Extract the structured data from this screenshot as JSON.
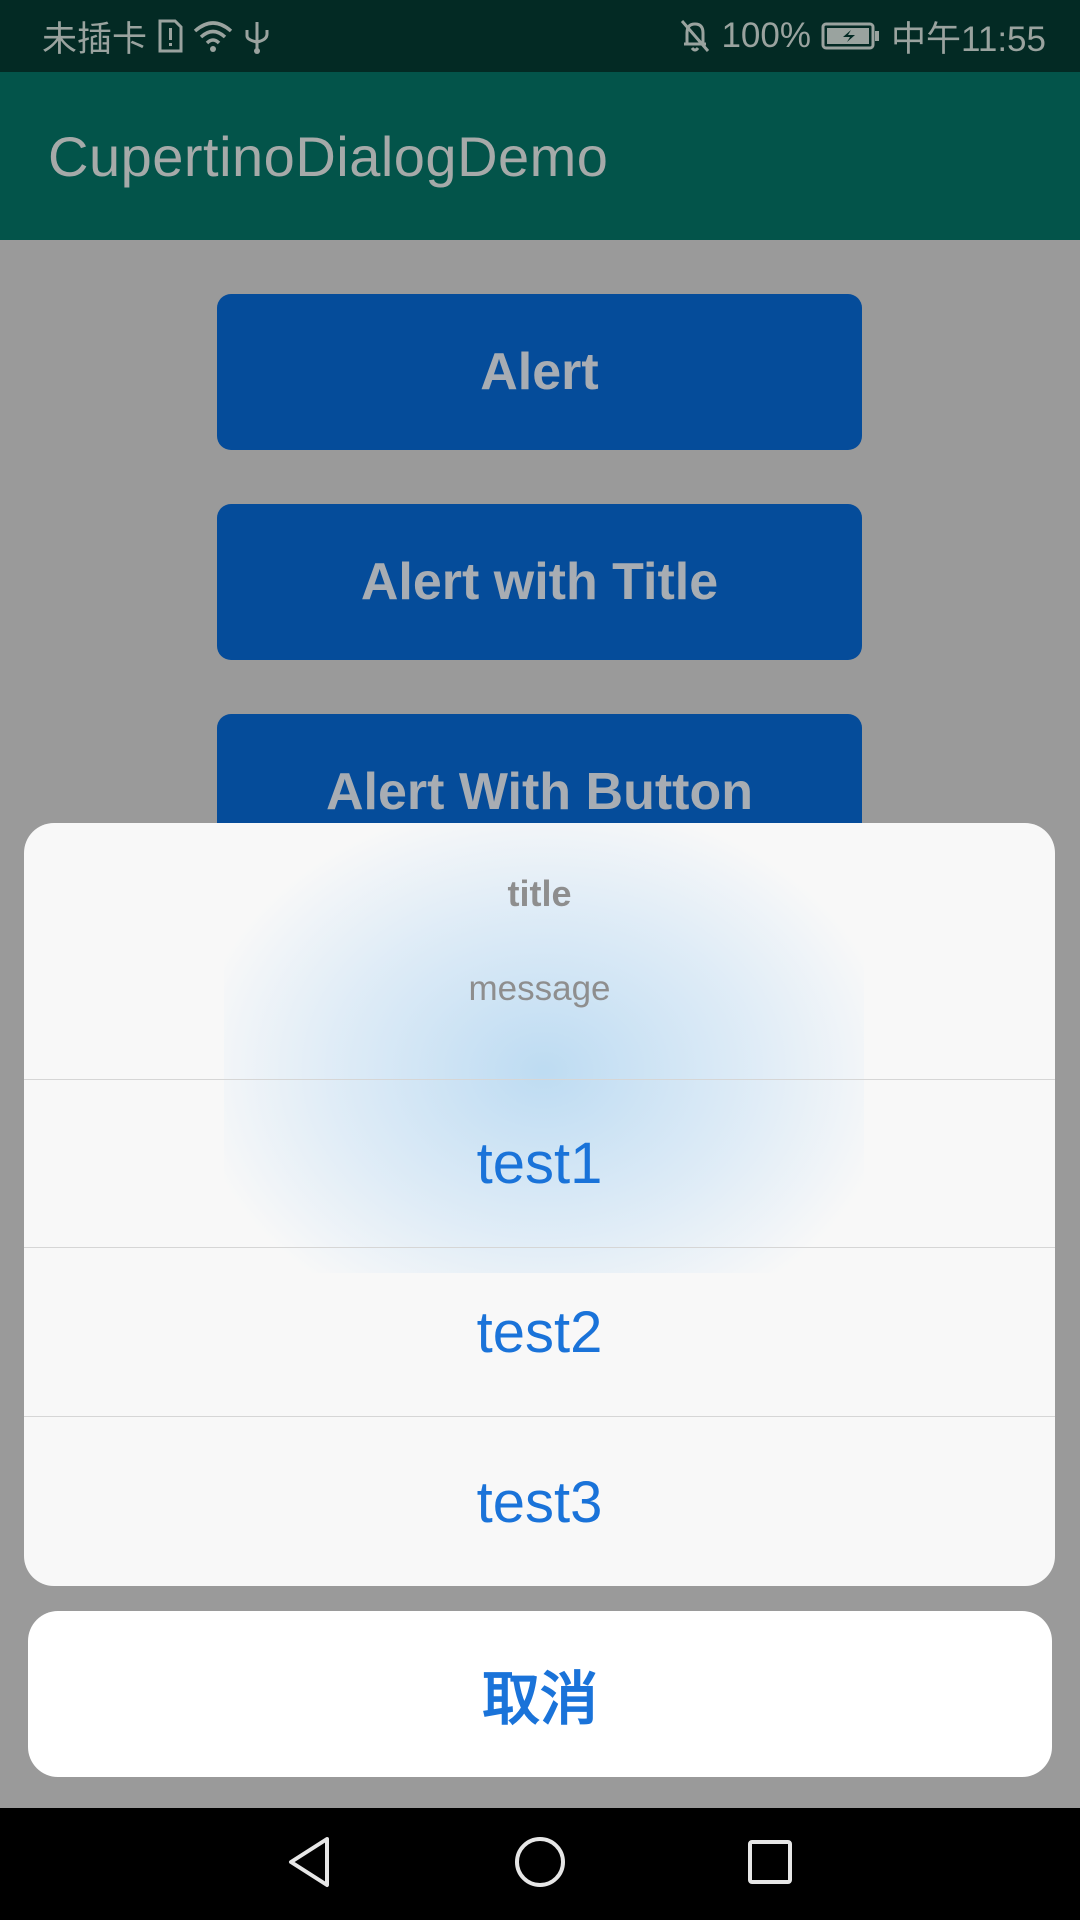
{
  "status_bar": {
    "carrier": "未插卡",
    "battery_percent": "100%",
    "time": "中午11:55",
    "icons": [
      "sim-alert-icon",
      "wifi-icon",
      "usb-icon",
      "bell-off-icon",
      "battery-charging-icon"
    ]
  },
  "app_bar": {
    "title": "CupertinoDialogDemo"
  },
  "buttons": {
    "alert": "Alert",
    "alert_with_title": "Alert with Title",
    "alert_with_button": "Alert With Button"
  },
  "action_sheet": {
    "title": "title",
    "message": "message",
    "actions": [
      "test1",
      "test2",
      "test3"
    ],
    "cancel": "取消"
  },
  "nav_bar": {
    "icons": [
      "back-icon",
      "home-icon",
      "recents-icon"
    ]
  },
  "colors": {
    "status_bar_bg": "#032a24",
    "app_bar_bg": "#03544a",
    "button_bg": "#054c9a",
    "scrim": "#9a9a9a",
    "action_text": "#1a73d9"
  }
}
